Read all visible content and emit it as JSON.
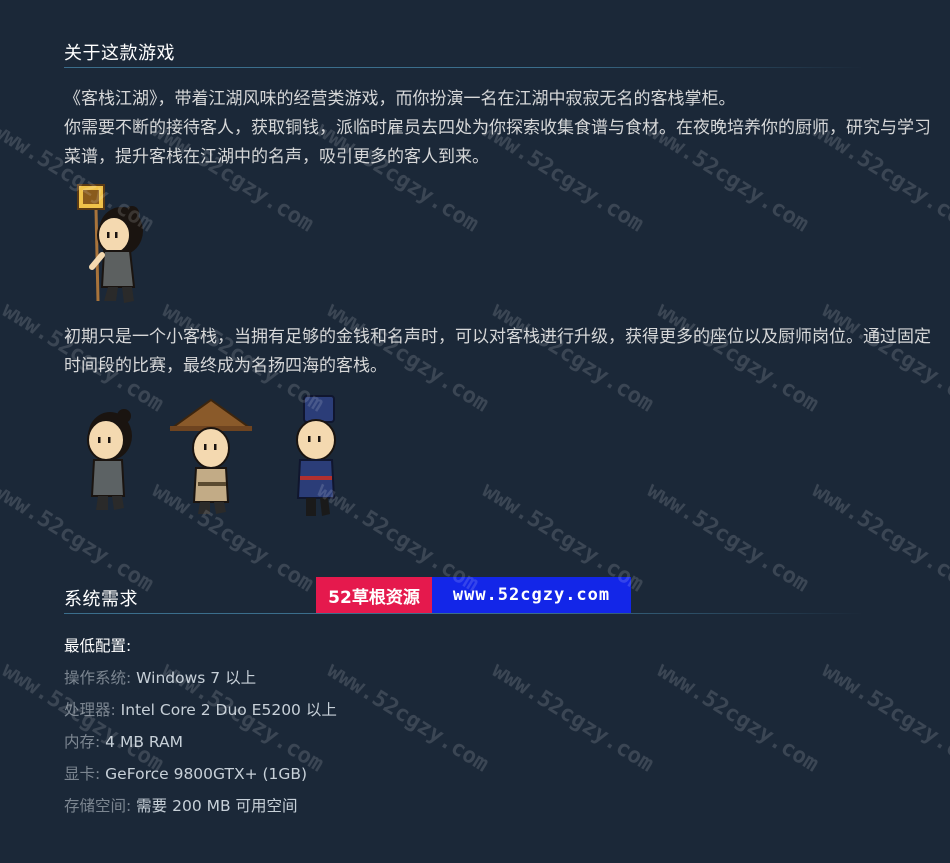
{
  "about": {
    "title": "关于这款游戏",
    "paragraph1_line1": "《客栈江湖》，带着江湖风味的经营类游戏，而你扮演一名在江湖中寂寂无名的客栈掌柜。",
    "paragraph1_line2": "你需要不断的接待客人，获取铜钱，派临时雇员去四处为你探索收集食谱与食材。在夜晚培养你的厨师，研究与学习菜谱，提升客栈在江湖中的名声，吸引更多的客人到来。",
    "paragraph2": "初期只是一个小客栈，当拥有足够的金钱和名声时，可以对客栈进行升级，获得更多的座位以及厨师岗位。通过固定时间段的比赛，最终成为名扬四海的客栈。"
  },
  "sysreq": {
    "title": "系统需求",
    "min_label": "最低配置:",
    "rows": [
      {
        "label": "操作系统:",
        "value": "Windows 7 以上"
      },
      {
        "label": "处理器:",
        "value": "Intel Core 2 Duo E5200 以上"
      },
      {
        "label": "内存:",
        "value": "4 MB RAM"
      },
      {
        "label": "显卡:",
        "value": "GeForce 9800GTX+ (1GB)"
      },
      {
        "label": "存储空间:",
        "value": "需要 200 MB 可用空间"
      }
    ]
  },
  "banner": {
    "left": "52草根资源",
    "right": "www.52cgzy.com"
  },
  "watermark_text": "www.52cgzy.com",
  "colors": {
    "background": "#1b2838",
    "banner_red": "#e5194d",
    "banner_blue": "#1326e8"
  }
}
